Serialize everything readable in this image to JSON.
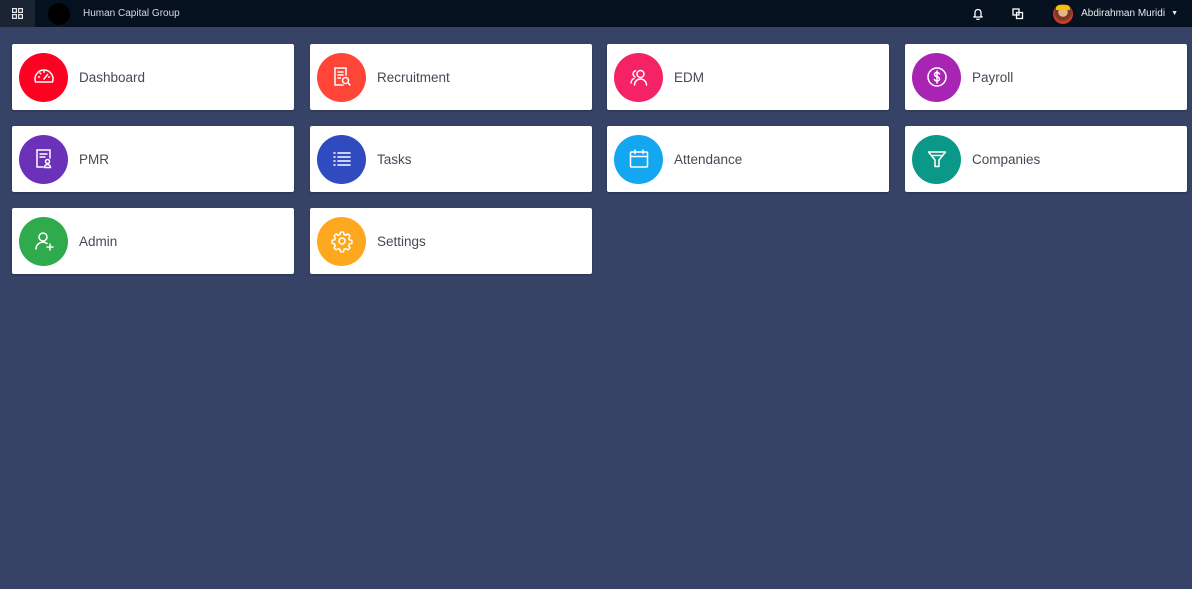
{
  "topbar": {
    "company_name": "Human Capital Group",
    "user_name": "Abdirahman Muridi",
    "icons": {
      "apps": "apps-grid-icon",
      "notifications": "bell-icon",
      "windows": "windows-icon",
      "dropdown": "caret-down-icon"
    }
  },
  "modules": [
    {
      "label": "Dashboard",
      "color": "#ff0022",
      "icon": "speedometer-icon"
    },
    {
      "label": "Recruitment",
      "color": "#ff4438",
      "icon": "document-search-icon"
    },
    {
      "label": "EDM",
      "color": "#f52266",
      "icon": "users-icon"
    },
    {
      "label": "Payroll",
      "color": "#a825b4",
      "icon": "dollar-icon"
    },
    {
      "label": "PMR",
      "color": "#6b32b9",
      "icon": "certificate-icon"
    },
    {
      "label": "Tasks",
      "color": "#2f4bbf",
      "icon": "list-icon"
    },
    {
      "label": "Attendance",
      "color": "#12a7f0",
      "icon": "calendar-icon"
    },
    {
      "label": "Companies",
      "color": "#0a9889",
      "icon": "funnel-icon"
    },
    {
      "label": "Admin",
      "color": "#2fab4e",
      "icon": "user-add-icon"
    },
    {
      "label": "Settings",
      "color": "#fea81f",
      "icon": "gear-icon"
    }
  ]
}
